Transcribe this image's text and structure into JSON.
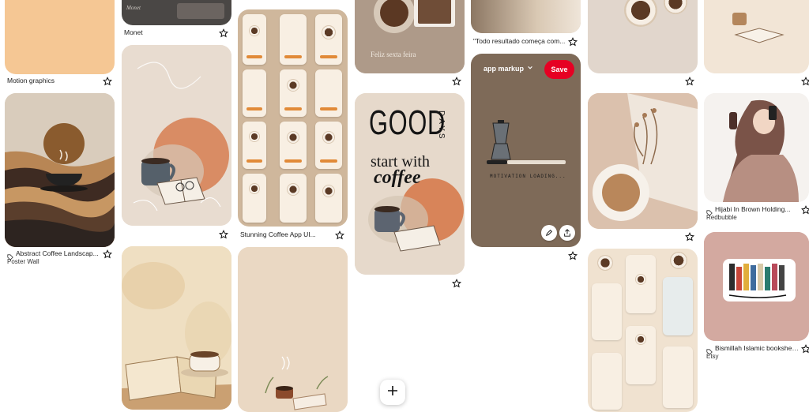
{
  "column1": {
    "pin1_title": "Motion graphics",
    "pin2_title": "Abstract Coffee Landscap...",
    "pin2_source": "Poster Wall"
  },
  "column2": {
    "pin1_title": "Monet",
    "pin1_overlay": "Monet"
  },
  "column3": {
    "pin1_title": "Stunning Coffee App UI..."
  },
  "column4": {
    "pin1_overlay": "Feliz sexta feira",
    "pin2_headline_1": "GOOD",
    "pin2_headline_2": "DAYS",
    "pin2_headline_3": "start with",
    "pin2_headline_4": "coffee"
  },
  "column5": {
    "pin1_title": "\"Todo resultado começa com...",
    "hover_board": "app markup",
    "save_label": "Save",
    "loading_text": "MOTIVATION LOADING..."
  },
  "column7": {
    "pin2_title": "Hijabi In Brown Holding...",
    "pin2_source": "Redbubble",
    "pin3_title": "Bismillah Islamic bookshelf...",
    "pin3_source": "Etsy"
  },
  "fab": {
    "icon": "plus-icon"
  },
  "colors": {
    "save": "#e60023",
    "accent": "#e18a38"
  }
}
